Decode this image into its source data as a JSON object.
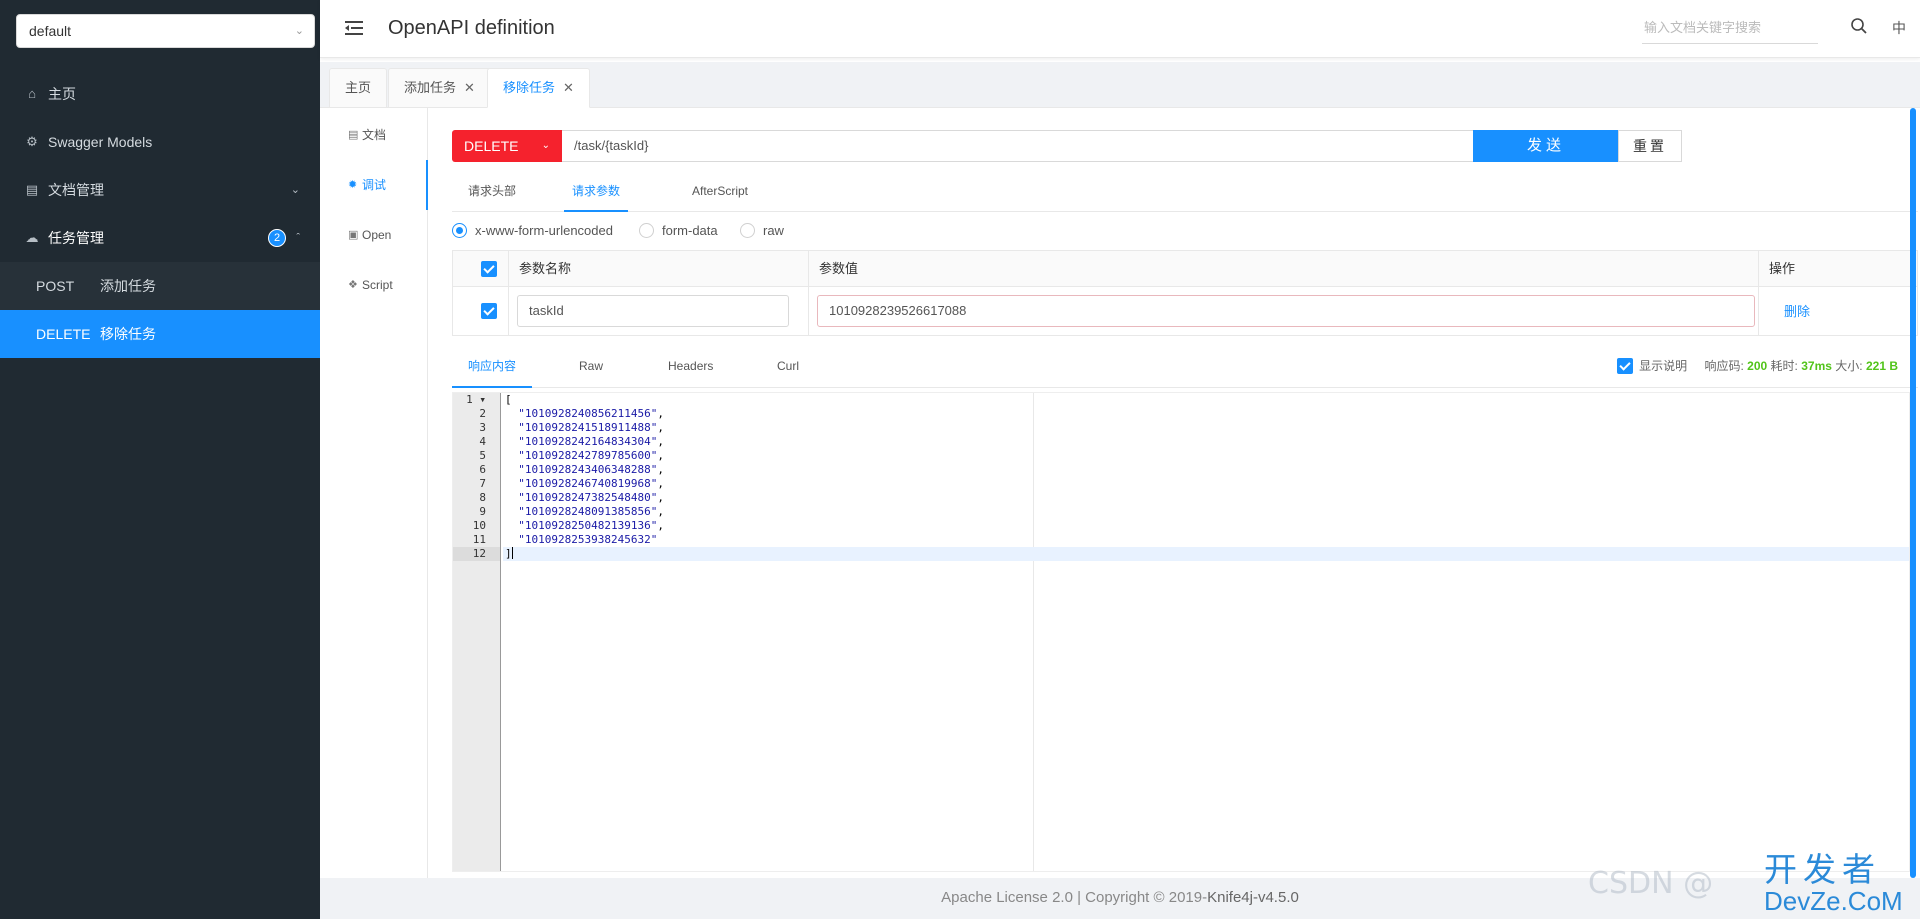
{
  "sidebar": {
    "group": "default",
    "items": [
      {
        "label": "主页",
        "icon": "home-icon"
      },
      {
        "label": "Swagger Models",
        "icon": "gear-icon"
      },
      {
        "label": "文档管理",
        "icon": "doc-icon"
      },
      {
        "label": "任务管理",
        "icon": "cloud-icon",
        "badge": "2"
      }
    ],
    "subitems": [
      {
        "method": "POST",
        "label": "添加任务"
      },
      {
        "method": "DELETE",
        "label": "移除任务"
      }
    ]
  },
  "header": {
    "title": "OpenAPI definition",
    "search_placeholder": "输入文档关键字搜索",
    "lang": "中"
  },
  "tabs": [
    {
      "label": "主页"
    },
    {
      "label": "添加任务"
    },
    {
      "label": "移除任务"
    }
  ],
  "vtabs": [
    {
      "label": "文档",
      "icon": "doc-icon"
    },
    {
      "label": "调试",
      "icon": "bug-icon"
    },
    {
      "label": "Open",
      "icon": "file-icon"
    },
    {
      "label": "Script",
      "icon": "code-icon"
    }
  ],
  "request": {
    "method": "DELETE",
    "url": "/task/{taskId}",
    "send": "发送",
    "reset": "重置"
  },
  "param_tabs": [
    "请求头部",
    "请求参数",
    "AfterScript"
  ],
  "content_types": [
    "x-www-form-urlencoded",
    "form-data",
    "raw"
  ],
  "params_table": {
    "headers": {
      "name": "参数名称",
      "value": "参数值",
      "action": "操作"
    },
    "rows": [
      {
        "name": "taskId",
        "value": "1010928239526617088",
        "action": "删除"
      }
    ]
  },
  "response_tabs": [
    "响应内容",
    "Raw",
    "Headers",
    "Curl"
  ],
  "response_info": {
    "show_desc": "显示说明",
    "code_label": "响应码:",
    "code": "200",
    "time_label": "耗时:",
    "time": "37ms",
    "size_label": "大小:",
    "size": "221 B"
  },
  "response_body": [
    "[",
    "  \"1010928240856211456\",",
    "  \"1010928241518911488\",",
    "  \"1010928242164834304\",",
    "  \"1010928242789785600\",",
    "  \"1010928243406348288\",",
    "  \"1010928246740819968\",",
    "  \"1010928247382548480\",",
    "  \"1010928248091385856\",",
    "  \"1010928250482139136\",",
    "  \"1010928253938245632\"",
    "]"
  ],
  "footer": {
    "license": "Apache License 2.0 | Copyright ",
    "copy": "© 2019-",
    "brand": "Knife4j-v4.5.0"
  },
  "watermark": {
    "csdn": "CSDN @",
    "site_cn": "开发者",
    "site_en": "DevZe.CoM"
  },
  "colors": {
    "accent": "#1890ff",
    "delete": "#f5222d",
    "sidebar": "#202a32",
    "success": "#52c41a"
  }
}
